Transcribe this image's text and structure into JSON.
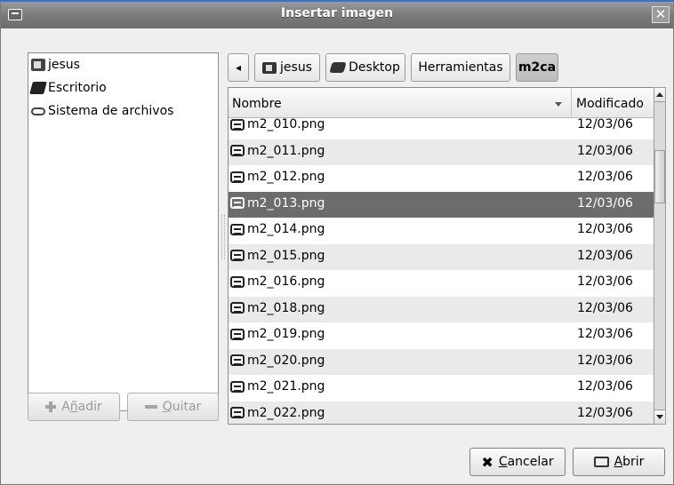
{
  "window": {
    "title": "Insertar imagen"
  },
  "places": [
    {
      "label": "jesus",
      "icon": "home-folder-icon"
    },
    {
      "label": "Escritorio",
      "icon": "desktop-icon"
    },
    {
      "label": "Sistema de archivos",
      "icon": "filesystem-icon"
    }
  ],
  "sidebar_buttons": {
    "add_prefix": "A",
    "add_mnemonic": "ñ",
    "add_rest": "adir",
    "remove_mnemonic": "Q",
    "remove_rest": "uitar"
  },
  "pathbar": {
    "back_arrow": "◂",
    "buttons": [
      {
        "label": "jesus"
      },
      {
        "label": "Desktop"
      },
      {
        "label": "Herramientas"
      },
      {
        "label": "m2ca",
        "active": true
      }
    ]
  },
  "filelist": {
    "columns": {
      "name": "Nombre",
      "modified": "Modificado"
    },
    "rows": [
      {
        "name": "m2_010.png",
        "date": "12/03/06"
      },
      {
        "name": "m2_011.png",
        "date": "12/03/06"
      },
      {
        "name": "m2_012.png",
        "date": "12/03/06"
      },
      {
        "name": "m2_013.png",
        "date": "12/03/06",
        "selected": true
      },
      {
        "name": "m2_014.png",
        "date": "12/03/06"
      },
      {
        "name": "m2_015.png",
        "date": "12/03/06"
      },
      {
        "name": "m2_016.png",
        "date": "12/03/06"
      },
      {
        "name": "m2_018.png",
        "date": "12/03/06"
      },
      {
        "name": "m2_019.png",
        "date": "12/03/06"
      },
      {
        "name": "m2_020.png",
        "date": "12/03/06"
      },
      {
        "name": "m2_021.png",
        "date": "12/03/06"
      },
      {
        "name": "m2_022.png",
        "date": "12/03/06"
      }
    ]
  },
  "actions": {
    "cancel_mnemonic": "C",
    "cancel_rest": "ancelar",
    "open_mnemonic": "A",
    "open_rest": "brir"
  },
  "colors": {
    "selection": "#6c6c6c",
    "titlebar": "#7b7b7b",
    "titlebar_accent": "#3d6ebf"
  }
}
